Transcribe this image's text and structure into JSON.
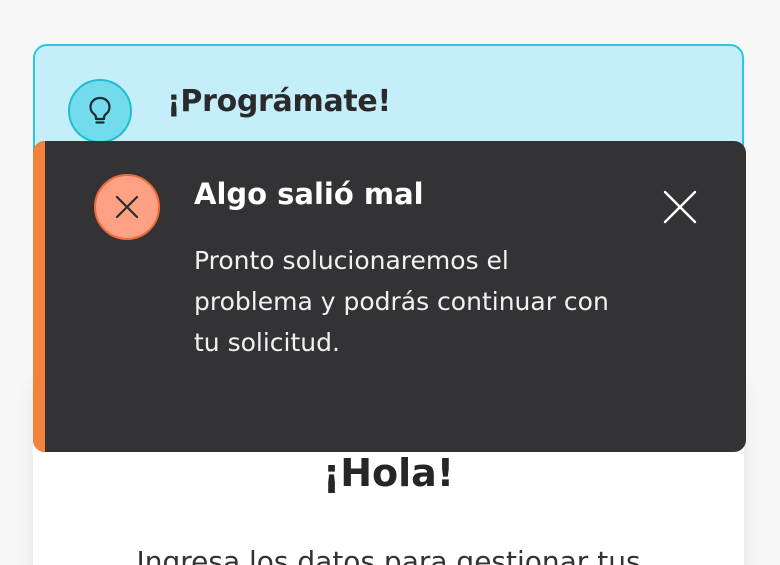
{
  "tip_banner": {
    "title": "¡Prográmate!",
    "icon": "lightbulb-icon"
  },
  "toast": {
    "title": "Algo salió mal",
    "message": "Pronto solucionaremos el problema y podrás continuar con tu solicitud.",
    "icon": "error-x-icon",
    "close_icon": "close-icon",
    "accent_color": "#f5823a",
    "background_color": "#333335"
  },
  "main_card": {
    "title": "¡Hola!",
    "subtitle": "Ingresa los datos para gestionar tus"
  }
}
